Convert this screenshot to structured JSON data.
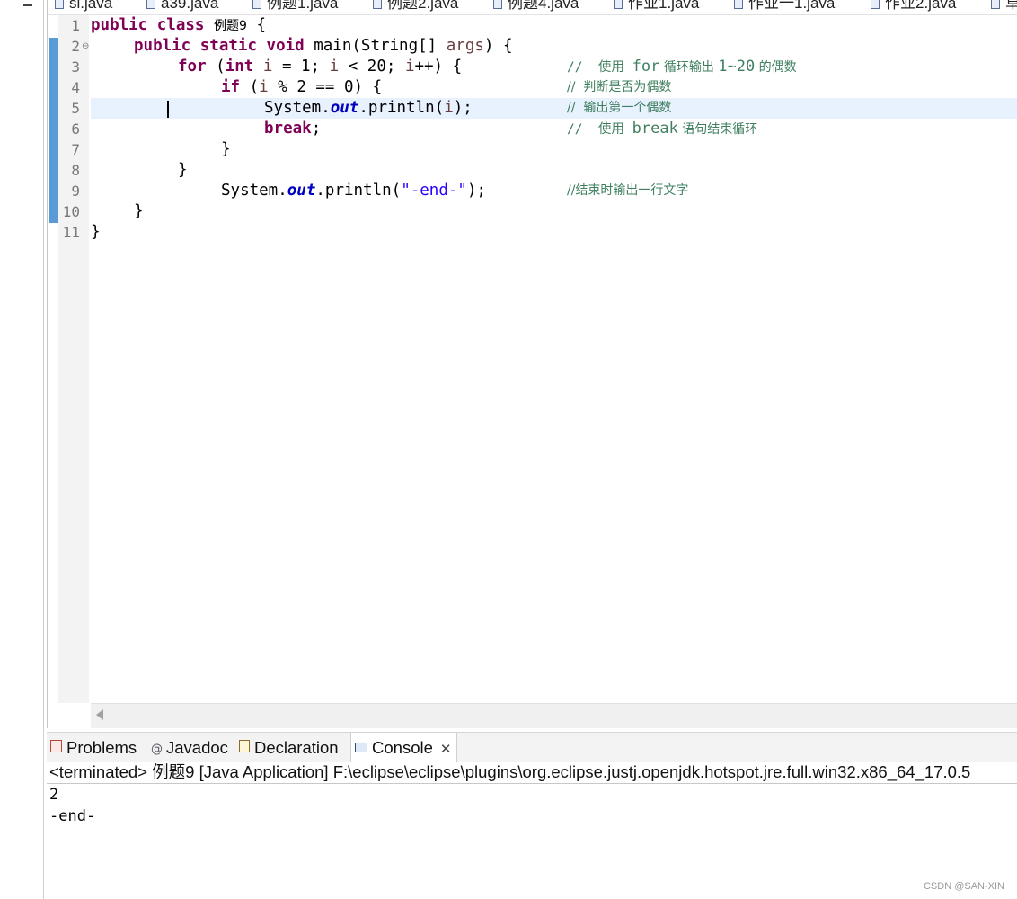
{
  "editor": {
    "tabs": [
      "sl.java",
      "a39.java",
      "例题1.java",
      "例题2.java",
      "例题4.java",
      "作业1.java",
      "作业一1.java",
      "作业2.java",
      "草"
    ],
    "line_numbers": [
      "1",
      "2",
      "3",
      "4",
      "5",
      "6",
      "7",
      "8",
      "9",
      "10",
      "11"
    ],
    "code": {
      "l1_kw1": "public",
      "l1_kw2": "class",
      "l1_name": "例题9",
      "l1_brace": "{",
      "l2_kw1": "public",
      "l2_kw2": "static",
      "l2_kw3": "void",
      "l2_sig": "main(String[] ",
      "l2_param": "args",
      "l2_end": ") {",
      "l3_kw1": "for",
      "l3_p1": "(",
      "l3_kw2": "int",
      "l3_v1": "i",
      "l3_p2": " = 1; ",
      "l3_v2": "i",
      "l3_p3": " < 20; ",
      "l3_v3": "i",
      "l3_p4": "++) {",
      "l3_cm_a": "//  使用 ",
      "l3_cm_b": "for",
      "l3_cm_c": " 循环输出 ",
      "l3_cm_d": "1~20",
      "l3_cm_e": " 的偶数",
      "l4_kw": "if",
      "l4_p1": "(",
      "l4_v": "i",
      "l4_p2": " % 2 == 0) {",
      "l4_cm": "//  判断是否为偶数",
      "l5_p1": "System.",
      "l5_f": "out",
      "l5_p2": ".println(",
      "l5_v": "i",
      "l5_p3": ");",
      "l5_cm": "//  输出第一个偶数",
      "l6_kw": "break",
      "l6_p": ";",
      "l6_cm_a": "//  使用 ",
      "l6_cm_b": "break",
      "l6_cm_c": " 语句结束循环",
      "l7": "}",
      "l8": "}",
      "l9_p1": "System.",
      "l9_f": "out",
      "l9_p2": ".println(",
      "l9_s": "\"-end-\"",
      "l9_p3": ");",
      "l9_cm": "//结束时输出一行文字",
      "l10": "}",
      "l11": "}"
    }
  },
  "views": {
    "tabs": [
      "Problems",
      "Javadoc",
      "Declaration",
      "Console"
    ],
    "active": "Console"
  },
  "console": {
    "status": "<terminated> 例题9 [Java Application] F:\\eclipse\\eclipse\\plugins\\org.eclipse.justj.openjdk.hotspot.jre.full.win32.x86_64_17.0.5",
    "output": [
      "2",
      "-end-"
    ]
  },
  "watermark": "CSDN @SAN-XIN",
  "colors": {
    "keyword": "#7f0055",
    "comment": "#3f7f5f",
    "string": "#2a00ff",
    "field": "#0000c0",
    "local_var": "#6a3e3e",
    "current_line": "#e8f2fe",
    "change_bar": "#5b9bd5"
  }
}
